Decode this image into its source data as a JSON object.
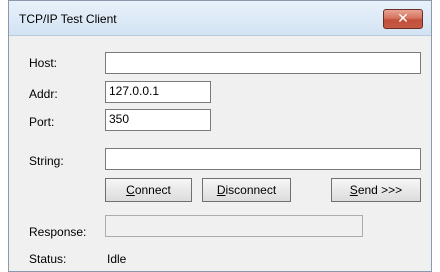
{
  "window": {
    "title": "TCP/IP Test Client",
    "close_glyph": "✕"
  },
  "form": {
    "host": {
      "label": "Host:",
      "value": ""
    },
    "addr": {
      "label": "Addr:",
      "value": "127.0.0.1"
    },
    "port": {
      "label": "Port:",
      "value": "350"
    },
    "string": {
      "label": "String:",
      "value": ""
    },
    "response": {
      "label": "Response:",
      "value": ""
    },
    "status": {
      "label": "Status:",
      "value": "Idle"
    }
  },
  "buttons": {
    "connect": {
      "mnemonic": "C",
      "rest": "onnect"
    },
    "disconnect": {
      "mnemonic": "D",
      "rest": "isconnect"
    },
    "send": {
      "mnemonic": "S",
      "rest": "end >>>"
    }
  }
}
